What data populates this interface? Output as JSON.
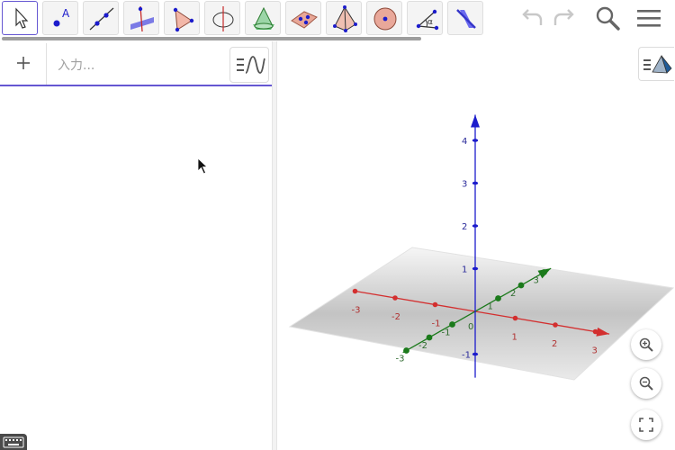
{
  "toolbar": {
    "tools": [
      {
        "name": "move-tool",
        "selected": true
      },
      {
        "name": "point-tool",
        "label": "A"
      },
      {
        "name": "line-tool"
      },
      {
        "name": "perpendicular-line-tool"
      },
      {
        "name": "polygon-tool"
      },
      {
        "name": "circle-axis-tool"
      },
      {
        "name": "plane-intersection-tool"
      },
      {
        "name": "plane-through-points-tool"
      },
      {
        "name": "pyramid-tool"
      },
      {
        "name": "sphere-tool"
      },
      {
        "name": "angle-tool",
        "label": "α"
      },
      {
        "name": "reflect-tool"
      }
    ],
    "actions": [
      "undo-icon",
      "redo-icon",
      "search-icon",
      "menu-icon"
    ]
  },
  "algebra": {
    "input_placeholder": "入力...",
    "plus_label": "+"
  },
  "graphics3d": {
    "colors": {
      "x_axis": "#d32f2f",
      "y_axis": "#1b7a1b",
      "z_axis": "#1c1ccc",
      "plane": "#8f8f8f"
    },
    "axes": {
      "x": {
        "range": [
          -3,
          3
        ],
        "ticks": [
          "-3",
          "-2",
          "-1",
          "0",
          "1",
          "2",
          "3"
        ]
      },
      "y": {
        "range": [
          -3,
          3
        ],
        "ticks": [
          "-3",
          "-2",
          "-1",
          "0",
          "1",
          "2",
          "3"
        ]
      },
      "z": {
        "range": [
          -1,
          4
        ],
        "ticks": [
          "-1",
          "1",
          "2",
          "3",
          "4"
        ]
      }
    },
    "zoom_buttons": [
      "zoom-in-icon",
      "zoom-out-icon",
      "fullscreen-icon"
    ]
  }
}
